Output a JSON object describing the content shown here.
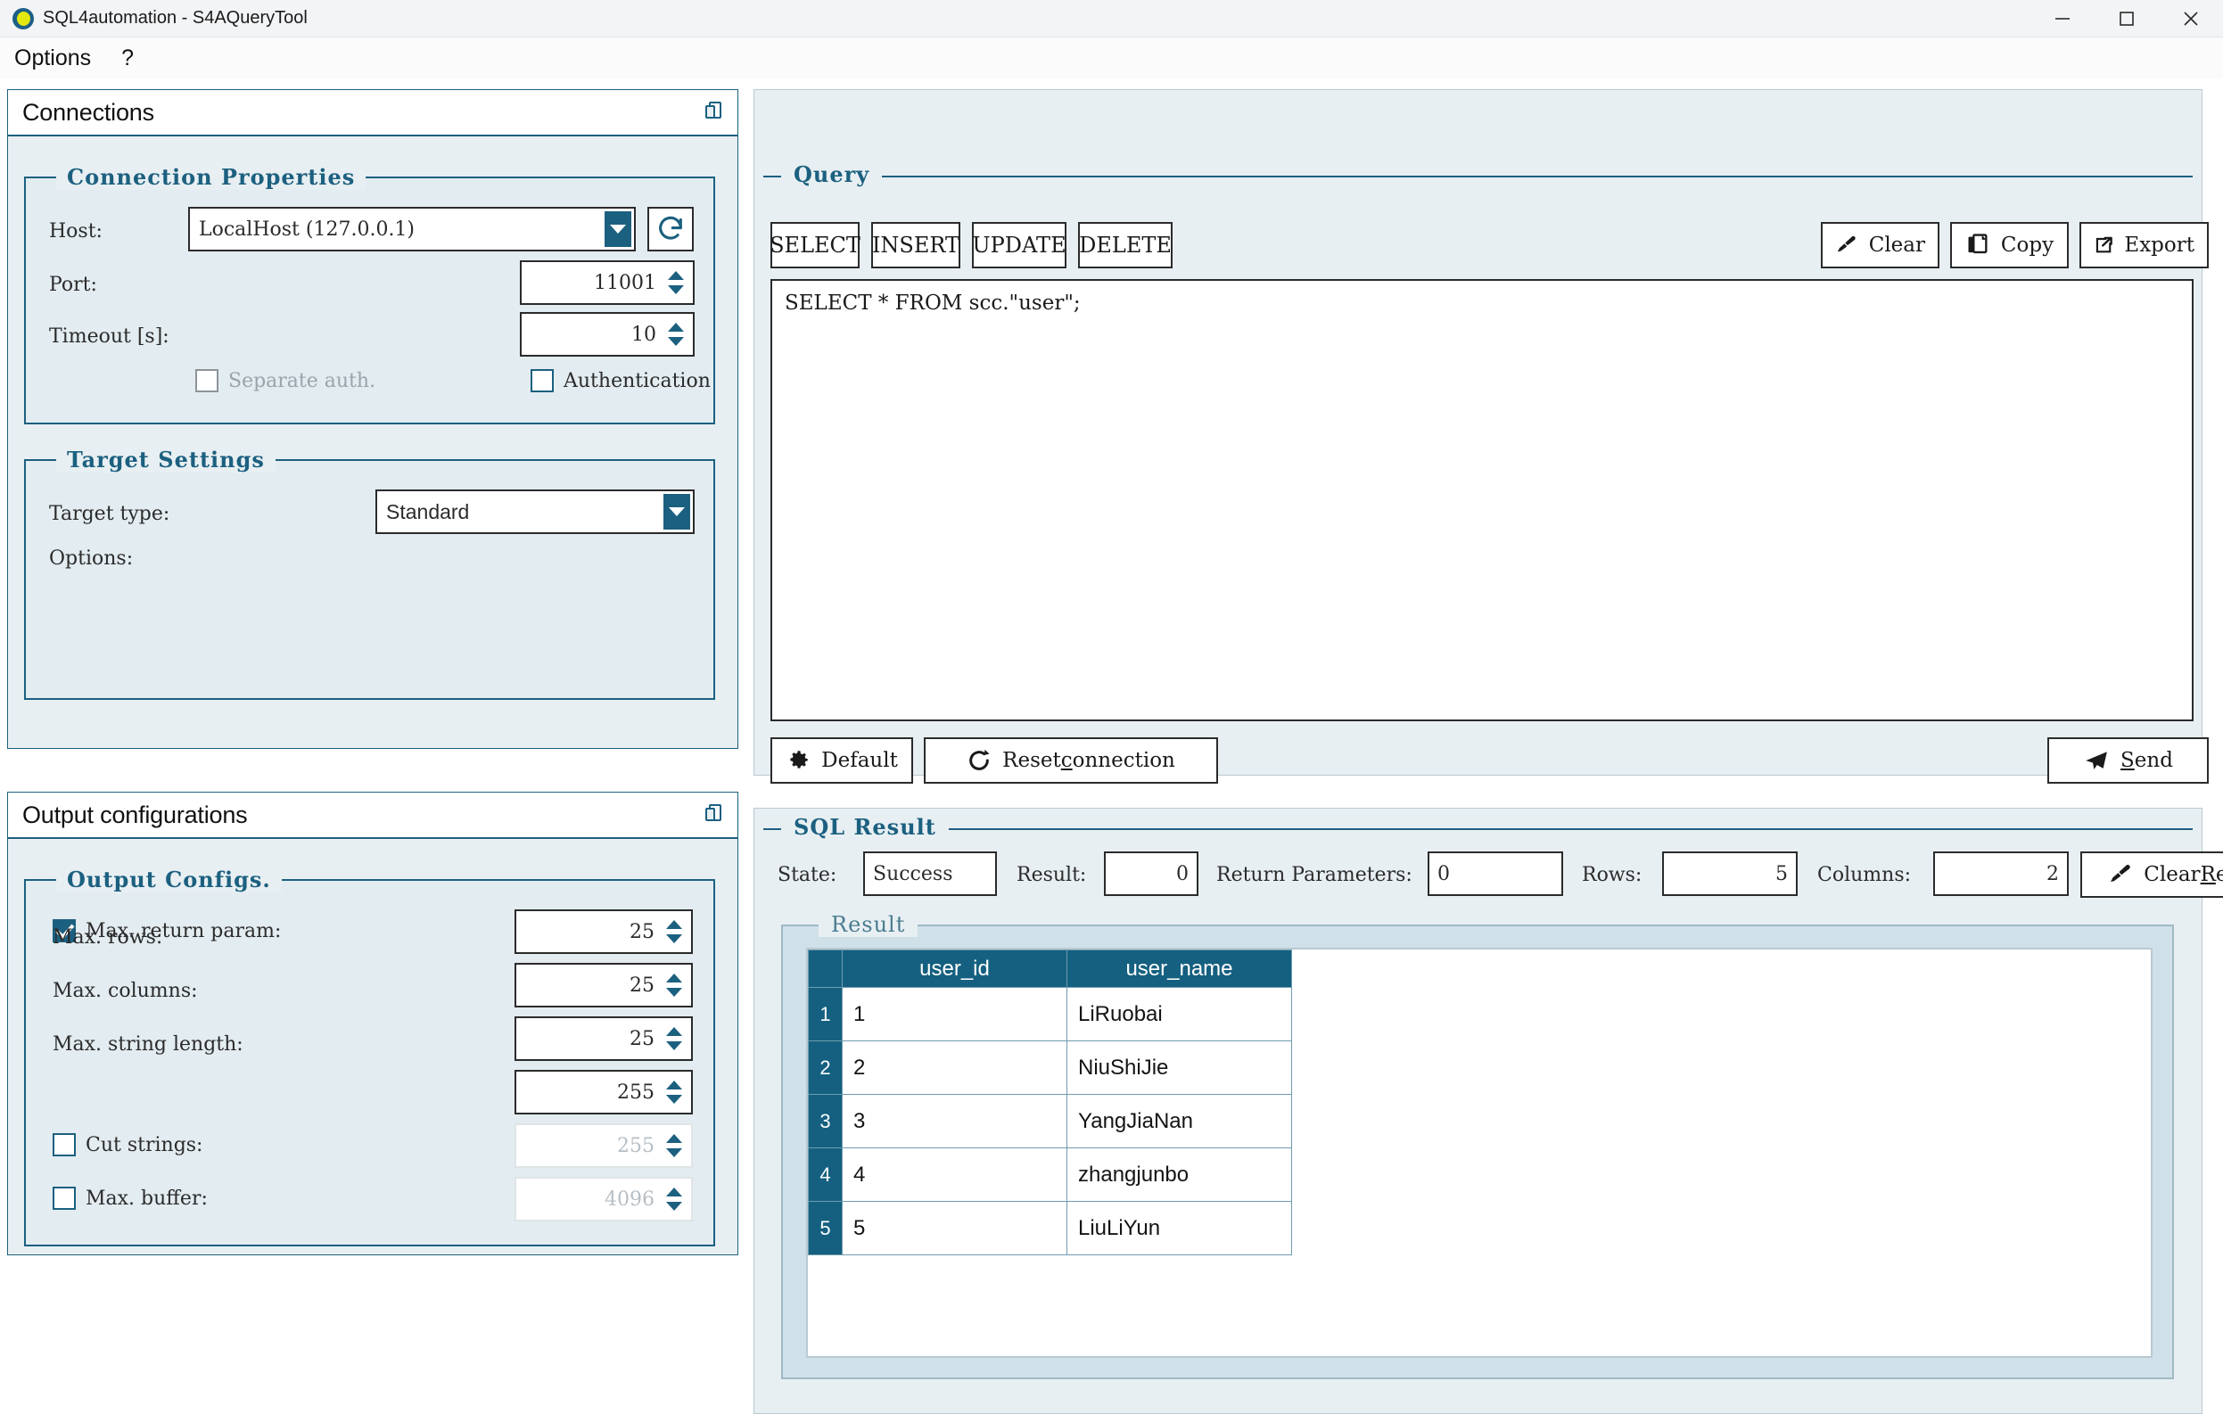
{
  "window": {
    "title": "SQL4automation - S4AQueryTool",
    "app_icon": "app-logo-icon",
    "minimize": "minimize-icon",
    "maximize": "maximize-icon",
    "close": "close-icon"
  },
  "menubar": {
    "items": [
      {
        "label": "Options"
      },
      {
        "label": "?"
      }
    ]
  },
  "connections_panel": {
    "title": "Connections",
    "float_icon": "float-window-icon",
    "connection_properties": {
      "legend": "Connection Properties",
      "host_label": "Host:",
      "host_value": "LocalHost (127.0.0.1)",
      "refresh_icon": "refresh-icon",
      "port_label": "Port:",
      "port_value": "11001",
      "timeout_label": "Timeout [s]:",
      "timeout_value": "10",
      "separate_auth_label": "Separate auth.",
      "separate_auth_checked": false,
      "separate_auth_disabled": true,
      "authentication_label": "Authentication",
      "authentication_checked": false
    },
    "target_settings": {
      "legend": "Target Settings",
      "target_type_label": "Target type:",
      "target_type_value": "Standard",
      "options_label": "Options:"
    }
  },
  "output_panel": {
    "title": "Output configurations",
    "float_icon": "float-window-icon",
    "output_configs": {
      "legend": "Output Configs.",
      "rows": [
        {
          "label": "Max. return param:",
          "value": "25",
          "has_checkbox": true,
          "checked": true,
          "disabled": false
        },
        {
          "label": "Max. rows:",
          "value": "25",
          "has_checkbox": false,
          "checked": false,
          "disabled": false
        },
        {
          "label": "Max. columns:",
          "value": "25",
          "has_checkbox": false,
          "checked": false,
          "disabled": false
        },
        {
          "label": "Max. string length:",
          "value": "255",
          "has_checkbox": false,
          "checked": false,
          "disabled": false
        },
        {
          "label": "Cut strings:",
          "value": "255",
          "has_checkbox": true,
          "checked": false,
          "disabled": true
        },
        {
          "label": "Max. buffer:",
          "value": "4096",
          "has_checkbox": true,
          "checked": false,
          "disabled": true
        }
      ]
    }
  },
  "query_panel": {
    "legend": "Query",
    "statement_buttons": [
      {
        "label": "SELECT"
      },
      {
        "label": "INSERT"
      },
      {
        "label": "UPDATE"
      },
      {
        "label": "DELETE"
      }
    ],
    "clear_button": {
      "label": "Clear",
      "icon": "brush-icon"
    },
    "copy_button": {
      "label": "Copy",
      "icon": "copy-icon"
    },
    "export_button": {
      "label": "Export",
      "icon": "export-icon"
    },
    "sql_text": "SELECT * FROM scc.\"user\";",
    "default_button": {
      "label": "Default",
      "icon": "gear-icon"
    },
    "reset_button": {
      "label_pre": "Reset ",
      "label_mnemonic": "c",
      "label_post": "onnection",
      "icon": "reset-icon"
    },
    "send_button": {
      "label_mnemonic": "S",
      "label_post": "end",
      "icon": "send-icon"
    }
  },
  "sql_result_panel": {
    "legend": "SQL Result",
    "state_label": "State:",
    "state_value": "Success",
    "result_label": "Result:",
    "result_value": "0",
    "return_parameters_label": "Return Parameters:",
    "return_parameters_value": "0",
    "rows_label": "Rows:",
    "rows_value": "5",
    "columns_label": "Columns:",
    "columns_value": "2",
    "clear_result_button": {
      "label_pre": "Clear ",
      "label_mnemonic": "R",
      "label_post": "esult",
      "icon": "brush-icon"
    },
    "result_group": {
      "legend": "Result",
      "columns": [
        "user_id",
        "user_name"
      ],
      "rows": [
        {
          "index": "1",
          "user_id": "1",
          "user_name": "LiRuobai"
        },
        {
          "index": "2",
          "user_id": "2",
          "user_name": "NiuShiJie"
        },
        {
          "index": "3",
          "user_id": "3",
          "user_name": "YangJiaNan"
        },
        {
          "index": "4",
          "user_id": "4",
          "user_name": "zhangjunbo"
        },
        {
          "index": "5",
          "user_id": "5",
          "user_name": "LiuLiYun"
        }
      ]
    }
  },
  "colors": {
    "accent": "#1c6080",
    "table_header": "#156080",
    "panel_bg": "#e8eff2",
    "group_bg": "#e3ecf0"
  }
}
